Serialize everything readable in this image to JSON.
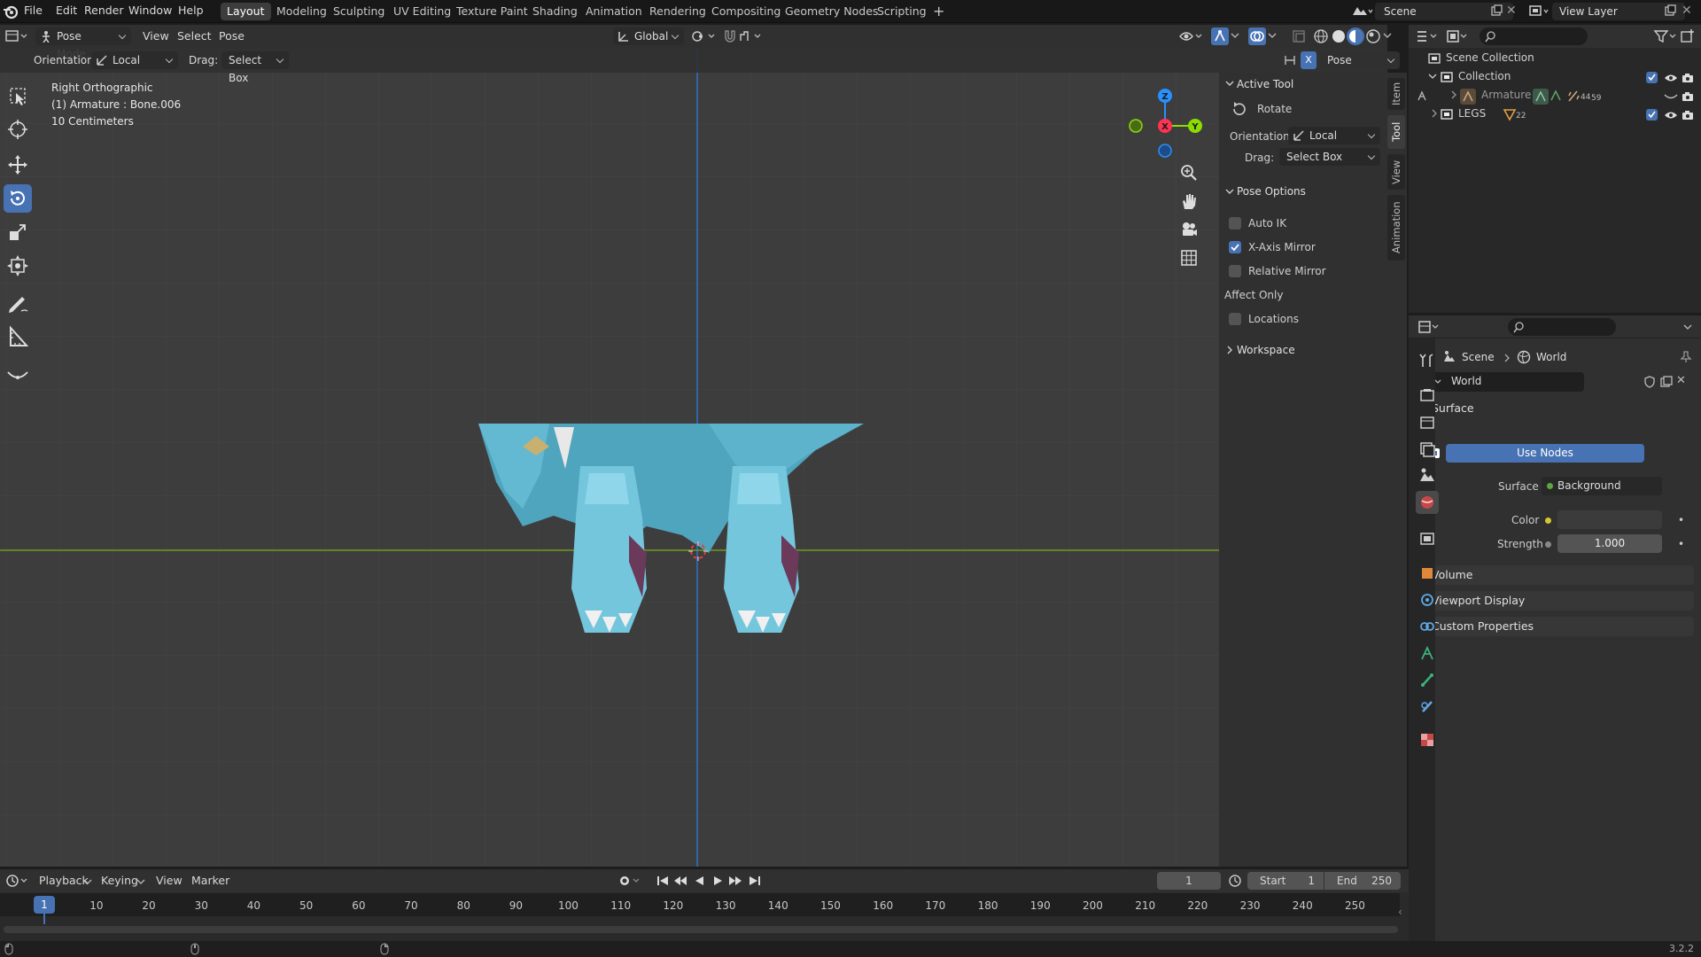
{
  "topbar": {
    "menus": [
      "File",
      "Edit",
      "Render",
      "Window",
      "Help"
    ],
    "workspaces": [
      "Layout",
      "Modeling",
      "Sculpting",
      "UV Editing",
      "Texture Paint",
      "Shading",
      "Animation",
      "Rendering",
      "Compositing",
      "Geometry Nodes",
      "Scripting"
    ],
    "active_workspace": "Layout",
    "add_tab": "+",
    "scene": "Scene",
    "view_layer": "View Layer"
  },
  "viewport_header": {
    "mode": "Pose Mode",
    "menus": [
      "View",
      "Select",
      "Pose"
    ],
    "transform_orientation": "Global"
  },
  "tool_header": {
    "orientation_label": "Orientation:",
    "orientation_value": "Local",
    "drag_label": "Drag:",
    "drag_value": "Select Box",
    "mirror_x": "X",
    "pose_options": "Pose Options"
  },
  "overlay_text": {
    "view": "Right Orthographic",
    "object": "(1) Armature : Bone.006",
    "scale": "10 Centimeters"
  },
  "gizmo": {
    "z": "Z",
    "x": "X",
    "y": "Y"
  },
  "colors": {
    "accent": "#4772b3",
    "axis_x": "#ff3352",
    "axis_y": "#8bdc00",
    "axis_z": "#2890ff",
    "model": "#5fb8cf"
  },
  "npanel": {
    "active_tool": "Active Tool",
    "tool_name": "Rotate",
    "orientation_label": "Orientation",
    "orientation_value": "Local",
    "drag_label": "Drag:",
    "drag_value": "Select Box",
    "pose_options": "Pose Options",
    "auto_ik": "Auto IK",
    "x_axis_mirror": "X-Axis Mirror",
    "relative_mirror": "Relative Mirror",
    "affect_only": "Affect Only",
    "locations": "Locations",
    "workspace": "Workspace",
    "auto_ik_checked": false,
    "x_mirror_checked": true,
    "relative_checked": false,
    "locations_checked": false
  },
  "side_tabs": [
    "Item",
    "Tool",
    "View",
    "Animation"
  ],
  "outliner": {
    "scene_collection": "Scene Collection",
    "collection": "Collection",
    "armature": "Armature",
    "armature_count1": "44",
    "armature_count2": "59",
    "legs": "LEGS",
    "legs_count": "22"
  },
  "properties": {
    "breadcrumb_scene": "Scene",
    "breadcrumb_world": "World",
    "world_name": "World",
    "surface_section": "Surface",
    "use_nodes": "Use Nodes",
    "surface_label": "Surface",
    "surface_value": "Background",
    "color_label": "Color",
    "strength_label": "Strength",
    "strength_value": "1.000",
    "volume": "Volume",
    "viewport_display": "Viewport Display",
    "custom_properties": "Custom Properties"
  },
  "timeline": {
    "menus": [
      "Playback",
      "Keying",
      "View",
      "Marker"
    ],
    "current_frame": "1",
    "start_label": "Start",
    "start_value": "1",
    "end_label": "End",
    "end_value": "250",
    "ticks": [
      "10",
      "20",
      "30",
      "40",
      "50",
      "60",
      "70",
      "80",
      "90",
      "100",
      "110",
      "120",
      "130",
      "140",
      "150",
      "160",
      "170",
      "180",
      "190",
      "200",
      "210",
      "220",
      "230",
      "240",
      "250"
    ],
    "playhead": "1"
  },
  "version": "3.2.2"
}
